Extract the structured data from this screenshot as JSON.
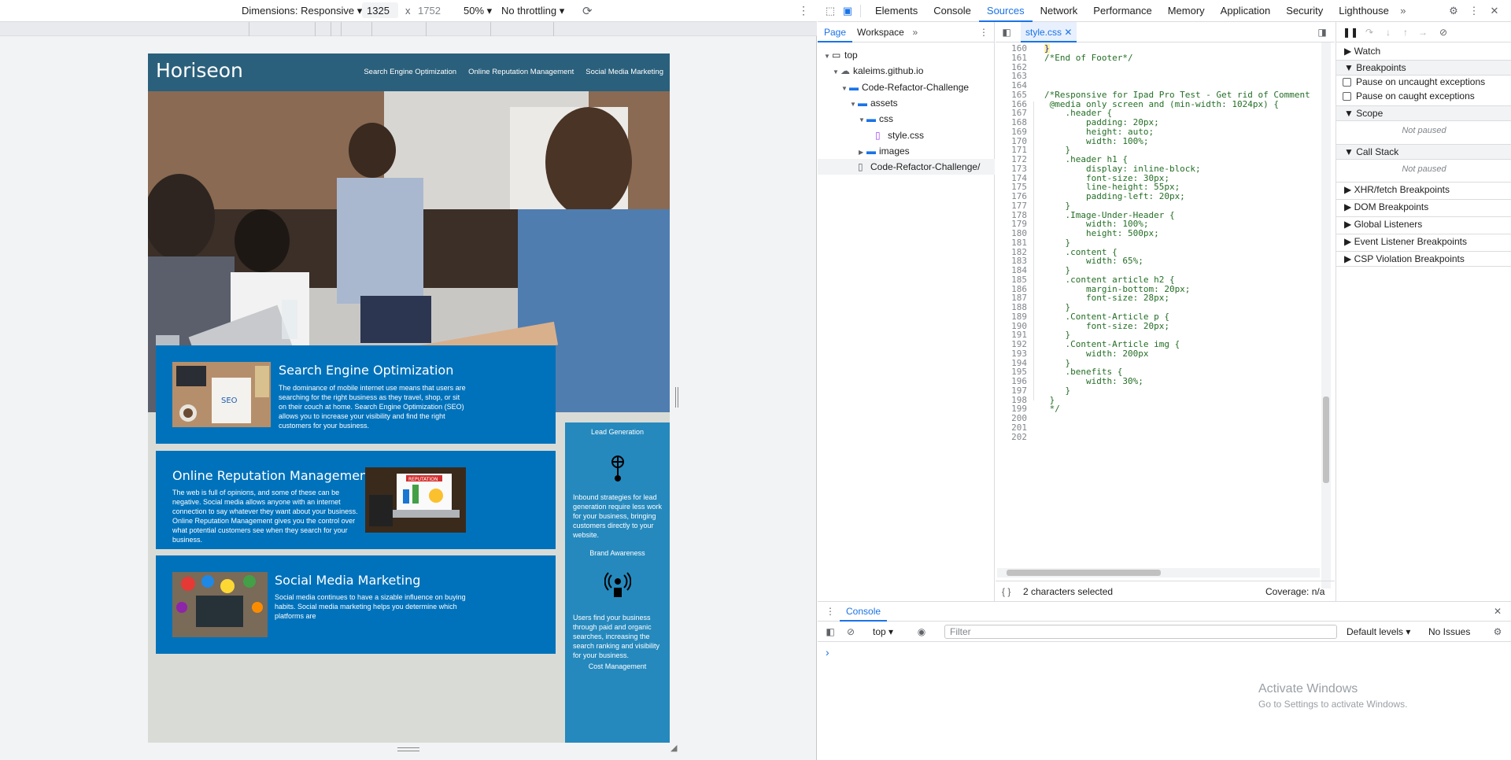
{
  "device_toolbar": {
    "dimensions_label": "Dimensions: Responsive",
    "width": "1325",
    "x": "x",
    "height": "1752",
    "zoom": "50%",
    "throttling": "No throttling"
  },
  "page": {
    "brand": "Horiseon",
    "nav": [
      "Search Engine Optimization",
      "Online Reputation Management",
      "Social Media Marketing"
    ],
    "cards": [
      {
        "title": "Search Engine Optimization",
        "text": "The dominance of mobile internet use means that users are searching for the right business as they travel, shop, or sit on their couch at home. Search Engine Optimization (SEO) allows you to increase your visibility and find the right customers for your business."
      },
      {
        "title": "Online Reputation Management",
        "text": "The web is full of opinions, and some of these can be negative. Social media allows anyone with an internet connection to say whatever they want about your business. Online Reputation Management gives you the control over what potential customers see when they search for your business."
      },
      {
        "title": "Social Media Marketing",
        "text": "Social media continues to have a sizable influence on buying habits. Social media marketing helps you determine which platforms are"
      }
    ],
    "thumb_label": "SEO",
    "thumb2_label": "REPUTATION",
    "aside": {
      "h1": "Lead Generation",
      "p1": "Inbound strategies for lead generation require less work for your business, bringing customers directly to your website.",
      "h2": "Brand Awareness",
      "p2": "Users find your business through paid and organic searches, increasing the search ranking and visibility for your business.",
      "h3": "Cost Management"
    }
  },
  "devtools": {
    "tabs": [
      "Elements",
      "Console",
      "Sources",
      "Network",
      "Performance",
      "Memory",
      "Application",
      "Security",
      "Lighthouse"
    ],
    "active_tab": "Sources",
    "nav_tabs": [
      "Page",
      "Workspace"
    ],
    "tree": [
      {
        "label": "top",
        "depth": 0,
        "arrow": "▼",
        "icon": "window-icon"
      },
      {
        "label": "kaleims.github.io",
        "depth": 1,
        "arrow": "▼",
        "icon": "cloud-icon"
      },
      {
        "label": "Code-Refactor-Challenge",
        "depth": 2,
        "arrow": "▼",
        "icon": "folder-icon"
      },
      {
        "label": "assets",
        "depth": 3,
        "arrow": "▼",
        "icon": "folder-icon"
      },
      {
        "label": "css",
        "depth": 4,
        "arrow": "▼",
        "icon": "folder-icon"
      },
      {
        "label": "style.css",
        "depth": 5,
        "arrow": "",
        "icon": "css-file-icon"
      },
      {
        "label": "images",
        "depth": 4,
        "arrow": "▶",
        "icon": "folder-icon"
      },
      {
        "label": "Code-Refactor-Challenge/",
        "depth": 3,
        "arrow": "",
        "icon": "file-icon"
      }
    ],
    "file_tab": "style.css",
    "code": [
      {
        "n": "160",
        "t": "}",
        "c": false
      },
      {
        "n": "161",
        "t": "/*End of Footer*/",
        "c": true
      },
      {
        "n": "162",
        "t": "",
        "c": false
      },
      {
        "n": "163",
        "t": "",
        "c": false
      },
      {
        "n": "164",
        "t": "",
        "c": false
      },
      {
        "n": "165",
        "t": "/*Responsive for Ipad Pro Test - Get rid of Comment",
        "c": true
      },
      {
        "n": "166",
        "t": " @media only screen and (min-width: 1024px) {",
        "c": true
      },
      {
        "n": "167",
        "t": "    .header {",
        "c": true
      },
      {
        "n": "168",
        "t": "        padding: 20px;",
        "c": true
      },
      {
        "n": "169",
        "t": "        height: auto;",
        "c": true
      },
      {
        "n": "170",
        "t": "        width: 100%;",
        "c": true
      },
      {
        "n": "171",
        "t": "    }",
        "c": true
      },
      {
        "n": "172",
        "t": "    .header h1 {",
        "c": true
      },
      {
        "n": "173",
        "t": "        display: inline-block;",
        "c": true
      },
      {
        "n": "174",
        "t": "        font-size: 30px;",
        "c": true
      },
      {
        "n": "175",
        "t": "        line-height: 55px;",
        "c": true
      },
      {
        "n": "176",
        "t": "        padding-left: 20px;",
        "c": true
      },
      {
        "n": "177",
        "t": "    }",
        "c": true
      },
      {
        "n": "178",
        "t": "    .Image-Under-Header {",
        "c": true
      },
      {
        "n": "179",
        "t": "        width: 100%;",
        "c": true
      },
      {
        "n": "180",
        "t": "        height: 500px;",
        "c": true
      },
      {
        "n": "181",
        "t": "    }",
        "c": true
      },
      {
        "n": "182",
        "t": "    .content {",
        "c": true
      },
      {
        "n": "183",
        "t": "        width: 65%;",
        "c": true
      },
      {
        "n": "184",
        "t": "    }",
        "c": true
      },
      {
        "n": "185",
        "t": "    .content article h2 {",
        "c": true
      },
      {
        "n": "186",
        "t": "        margin-bottom: 20px;",
        "c": true
      },
      {
        "n": "187",
        "t": "        font-size: 28px;",
        "c": true
      },
      {
        "n": "188",
        "t": "    }",
        "c": true
      },
      {
        "n": "189",
        "t": "    .Content-Article p {",
        "c": true
      },
      {
        "n": "190",
        "t": "        font-size: 20px;",
        "c": true
      },
      {
        "n": "191",
        "t": "    }",
        "c": true
      },
      {
        "n": "192",
        "t": "    .Content-Article img {",
        "c": true
      },
      {
        "n": "193",
        "t": "        width: 200px",
        "c": true
      },
      {
        "n": "194",
        "t": "    }",
        "c": true
      },
      {
        "n": "195",
        "t": "    .benefits {",
        "c": true
      },
      {
        "n": "196",
        "t": "        width: 30%;",
        "c": true
      },
      {
        "n": "197",
        "t": "    }",
        "c": true
      },
      {
        "n": "198",
        "t": " }",
        "c": true
      },
      {
        "n": "199",
        "t": " */",
        "c": true
      },
      {
        "n": "200",
        "t": "",
        "c": false
      },
      {
        "n": "201",
        "t": "",
        "c": false
      },
      {
        "n": "202",
        "t": "",
        "c": false
      }
    ],
    "status_selected": "2 characters selected",
    "coverage": "Coverage: n/a",
    "debugger": {
      "watch": "Watch",
      "breakpoints": "Breakpoints",
      "pause_uncaught": "Pause on uncaught exceptions",
      "pause_caught": "Pause on caught exceptions",
      "scope": "Scope",
      "not_paused": "Not paused",
      "call_stack": "Call Stack",
      "more": [
        "XHR/fetch Breakpoints",
        "DOM Breakpoints",
        "Global Listeners",
        "Event Listener Breakpoints",
        "CSP Violation Breakpoints"
      ]
    },
    "console": {
      "title": "Console",
      "context": "top",
      "filter_placeholder": "Filter",
      "levels": "Default levels",
      "issues": "No Issues",
      "prompt": "›"
    },
    "watermark": {
      "line1": "Activate Windows",
      "line2": "Go to Settings to activate Windows."
    }
  }
}
